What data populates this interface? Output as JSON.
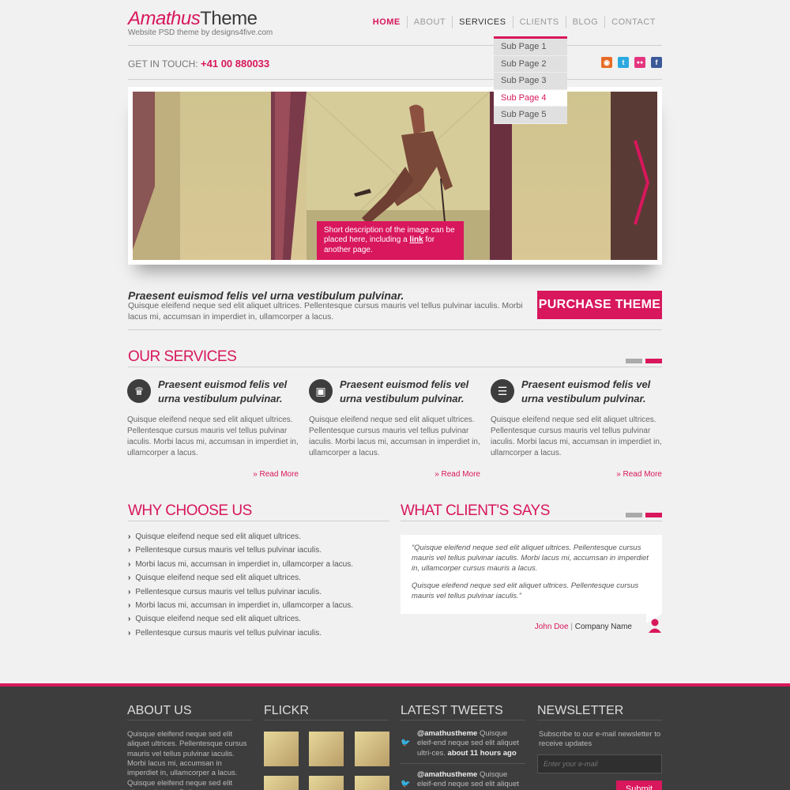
{
  "header": {
    "logo_main": "Amathus",
    "logo_bold": "Theme",
    "logo_tag": "Website PSD theme by designs4five.com",
    "nav": [
      "HOME",
      "ABOUT",
      "SERVICES",
      "CLIENTS",
      "BLOG",
      "CONTACT"
    ],
    "dropdown": [
      "Sub Page 1",
      "Sub Page 2",
      "Sub Page 3",
      "Sub Page 4",
      "Sub Page 5"
    ],
    "touch_label": "GET IN TOUCH:",
    "phone": "+41 00 880033"
  },
  "social": [
    {
      "icon": "rss-icon",
      "glyph": "◉",
      "color": "#e86b25"
    },
    {
      "icon": "twitter-icon",
      "glyph": "t",
      "color": "#2aa9e0"
    },
    {
      "icon": "flickr-icon",
      "glyph": "••",
      "color": "#e4357f"
    },
    {
      "icon": "facebook-icon",
      "glyph": "f",
      "color": "#3b5998"
    }
  ],
  "slider": {
    "caption_pre": "Short description of the image can be placed here, including a",
    "caption_link": "link",
    "caption_post": "for another page."
  },
  "intro": {
    "title": "Praesent euismod felis vel urna vestibulum pulvinar.",
    "text": "Quisque eleifend neque sed elit aliquet ultrices. Pellentesque cursus mauris vel tellus pulvinar iaculis.  Morbi lacus mi, accumsan in imperdiet in, ullamcorper a lacus.",
    "button": "PURCHASE THEME"
  },
  "services": {
    "title": "OUR SERVICES",
    "items": [
      {
        "icon": "crown-icon",
        "glyph": "♛",
        "head": "Praesent euismod felis vel urna vestibulum pulvinar.",
        "text": "Quisque eleifend neque sed elit aliquet ultrices. Pellentesque cursus mauris vel tellus pulvinar iaculis.  Morbi lacus mi, accumsan in imperdiet in, ullamcorper a lacus.",
        "more": "» Read More"
      },
      {
        "icon": "briefcase-icon",
        "glyph": "▣",
        "head": "Praesent euismod felis vel urna vestibulum pulvinar.",
        "text": "Quisque eleifend neque sed elit aliquet ultrices. Pellentesque cursus mauris vel tellus pulvinar iaculis.  Morbi lacus mi, accumsan in imperdiet in, ullamcorper a lacus.",
        "more": "» Read More"
      },
      {
        "icon": "chat-bubble-icon",
        "glyph": "☰",
        "head": "Praesent euismod felis vel urna vestibulum pulvinar.",
        "text": "Quisque eleifend neque sed elit aliquet ultrices. Pellentesque cursus mauris vel tellus pulvinar iaculis.  Morbi lacus mi, accumsan in imperdiet in, ullamcorper a lacus.",
        "more": "» Read More"
      }
    ]
  },
  "why": {
    "title": "WHY CHOOSE US",
    "items": [
      "Quisque eleifend neque sed elit aliquet ultrices.",
      "Pellentesque cursus mauris vel tellus pulvinar iaculis.",
      "Morbi lacus mi, accumsan in imperdiet in, ullamcorper a lacus.",
      "Quisque eleifend neque sed elit aliquet ultrices.",
      "Pellentesque cursus mauris vel tellus pulvinar iaculis.",
      "Morbi lacus mi, accumsan in imperdiet in, ullamcorper a lacus.",
      "Quisque eleifend neque sed elit aliquet ultrices.",
      "Pellentesque cursus mauris vel tellus pulvinar iaculis."
    ]
  },
  "clients": {
    "title": "WHAT CLIENT'S SAYS",
    "quote1": "“Quisque eleifend neque sed elit aliquet ultrices. Pellentesque cursus mauris vel tellus pulvinar iaculis. Morbi lacus mi, accumsan in imperdiet in, ullamcorper cursus mauris a lacus.",
    "quote2": "Quisque eleifend neque sed elit aliquet ultrices. Pellentesque cursus mauris vel tellus pulvinar iaculis.”",
    "name": "John Doe",
    "separator": "|",
    "company": "Company Name"
  },
  "footer": {
    "about_title": "ABOUT US",
    "about_text": "Quisque eleifend neque sed elit aliquet ultrices. Pellentesque cursus mauris vel tellus pulvinar iaculis.  Morbi lacus mi, accumsan in imperdiet in, ullamcorper a lacus. Quisque eleifend neque sed elit aliquet ultrices. Pellentesque cursus mauris vel tellus pulvinar iaculis.  Morbi",
    "flickr_title": "FLICKR",
    "tweets_title": "LATEST TWEETS",
    "tweets": [
      {
        "handle": "@amathustheme",
        "text": "Quisque eleif-end neque sed elit aliquet ultri-ces.",
        "time": "about 11 hours ago"
      },
      {
        "handle": "@amathustheme",
        "text": "Quisque eleif-end neque sed elit aliquet ultri-ces.",
        "time": ""
      }
    ],
    "news_title": "NEWSLETTER",
    "news_text": "Subscribe to our e-mail newsletter to receive updates",
    "email_placeholder": "Enter your e-mail",
    "submit": "Submit"
  },
  "colors": {
    "accent": "#d8175c",
    "footer_bg": "#3d3d3d"
  }
}
